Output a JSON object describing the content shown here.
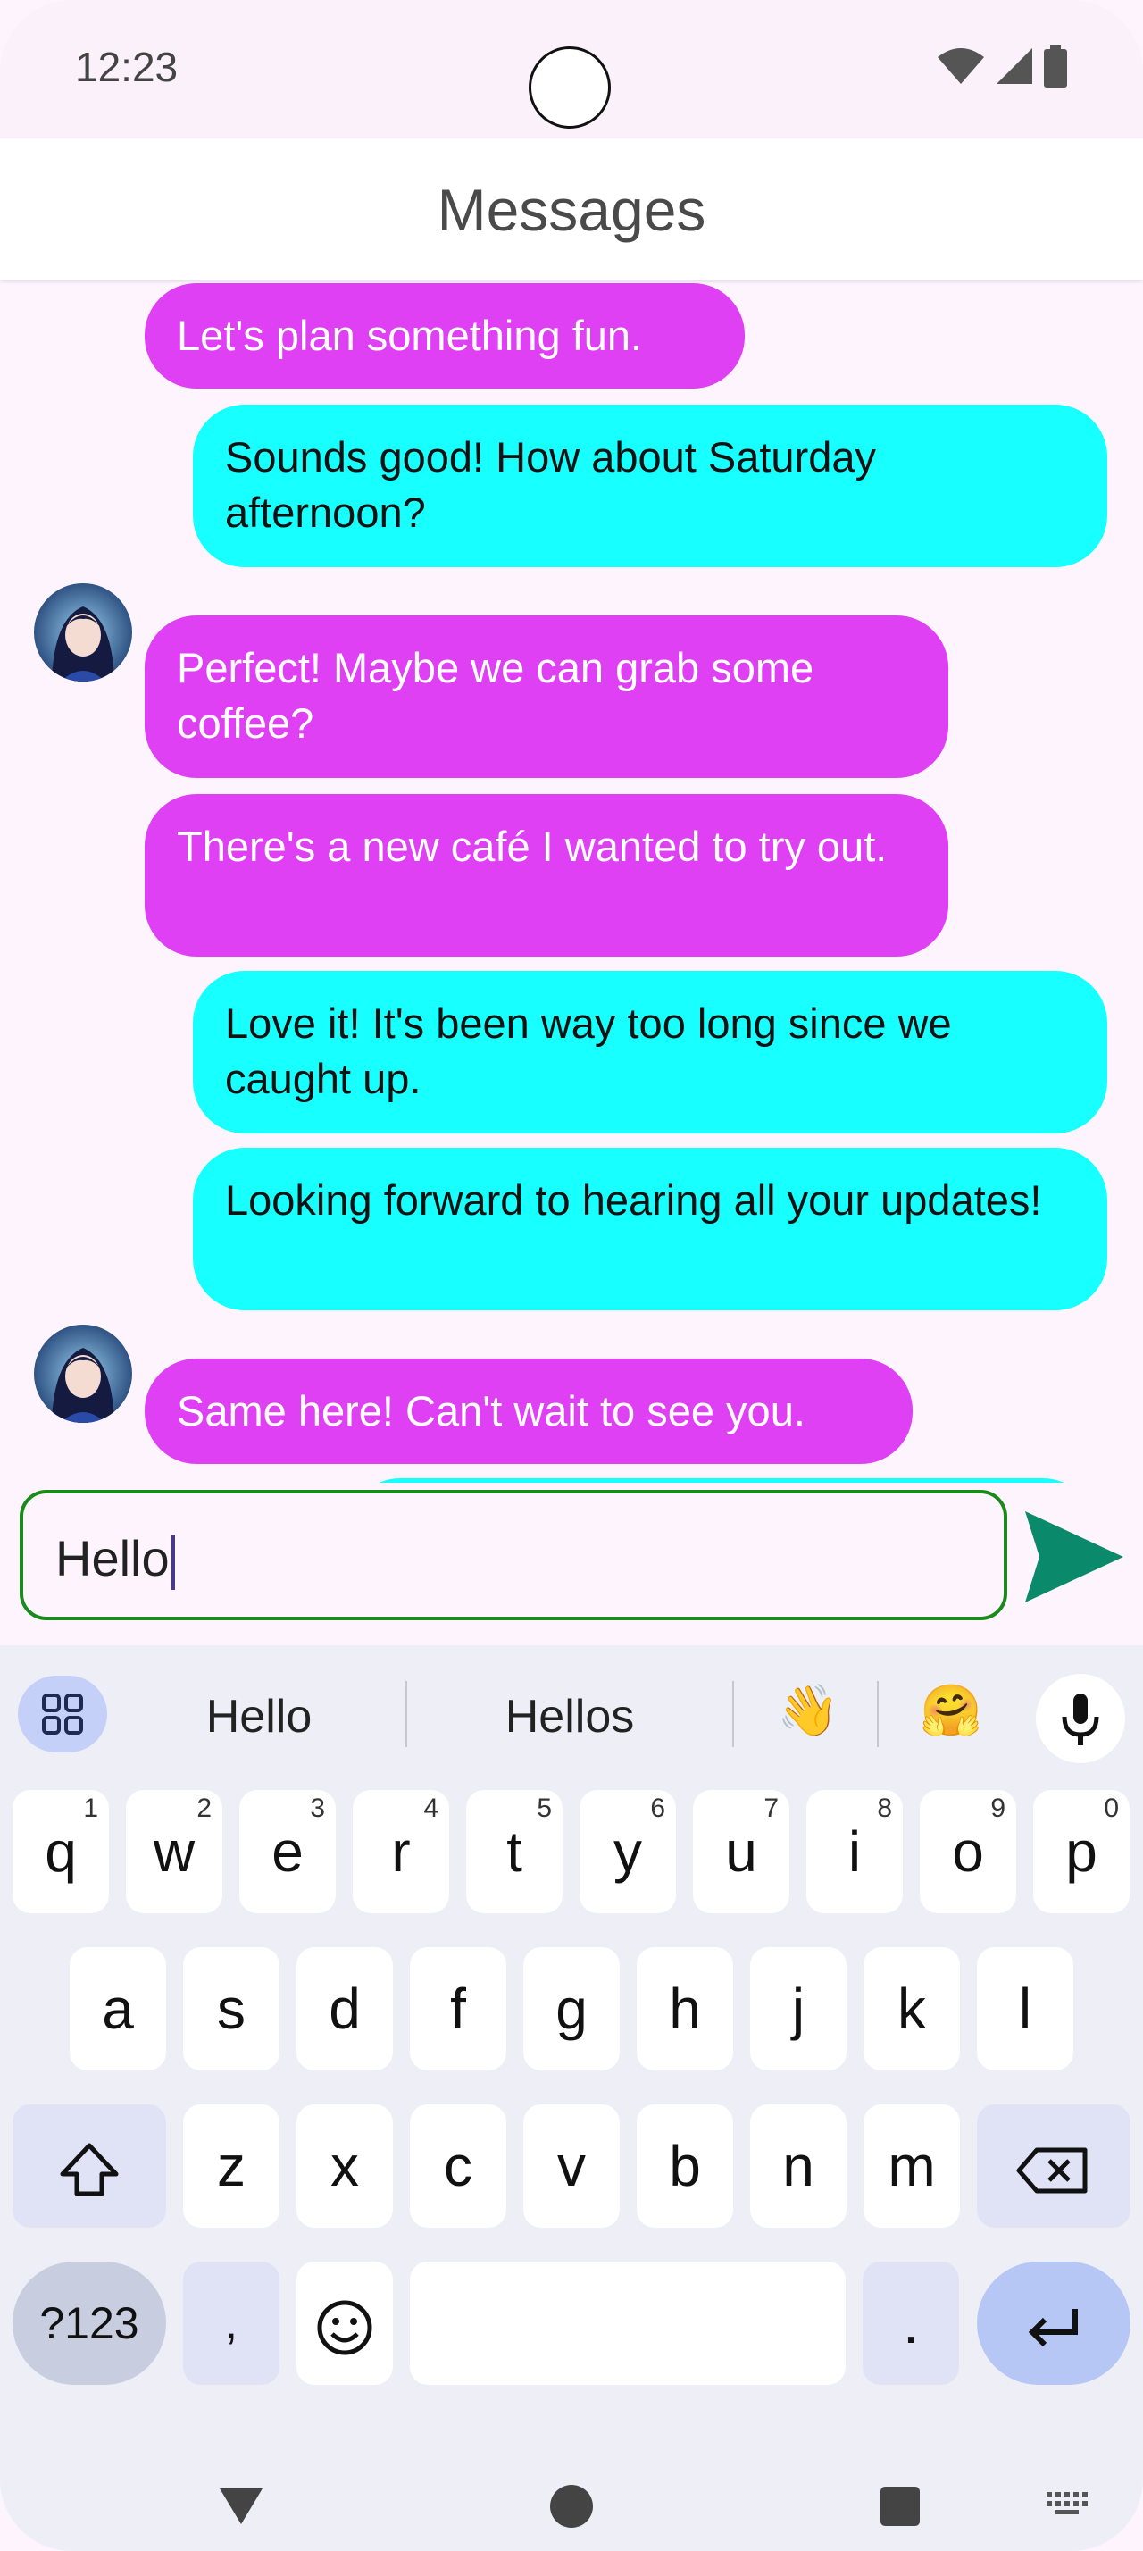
{
  "status_bar": {
    "time": "12:23"
  },
  "app_bar": {
    "title": "Messages"
  },
  "messages": [
    {
      "from": "them",
      "text": "Let's plan something fun."
    },
    {
      "from": "me",
      "text": "Sounds good! How about Saturday afternoon?"
    },
    {
      "from": "them",
      "text": "Perfect! Maybe we can grab some coffee?",
      "avatar": true
    },
    {
      "from": "them",
      "text": "There's a new café I wanted to try out."
    },
    {
      "from": "me",
      "text": "Love it! It's been way too long since we caught up."
    },
    {
      "from": "me",
      "text": "Looking forward to hearing all your updates!"
    },
    {
      "from": "them",
      "text": "Same here! Can't wait to see you.",
      "avatar": true
    }
  ],
  "composer": {
    "value": "Hello"
  },
  "keyboard": {
    "suggestions": [
      "Hello",
      "Hellos"
    ],
    "emoji_suggestions": [
      "👋",
      "🤗"
    ],
    "row1": [
      [
        "q",
        "1"
      ],
      [
        "w",
        "2"
      ],
      [
        "e",
        "3"
      ],
      [
        "r",
        "4"
      ],
      [
        "t",
        "5"
      ],
      [
        "y",
        "6"
      ],
      [
        "u",
        "7"
      ],
      [
        "i",
        "8"
      ],
      [
        "o",
        "9"
      ],
      [
        "p",
        "0"
      ]
    ],
    "row2": [
      "a",
      "s",
      "d",
      "f",
      "g",
      "h",
      "j",
      "k",
      "l"
    ],
    "row3": [
      "z",
      "x",
      "c",
      "v",
      "b",
      "n",
      "m"
    ],
    "sym_label": "?123",
    "comma": ",",
    "period": "."
  },
  "colors": {
    "incoming_bubble": "#e040f4",
    "outgoing_bubble": "#18ffff",
    "send_icon": "#0a8a6a",
    "field_border": "#1a8a1a"
  }
}
